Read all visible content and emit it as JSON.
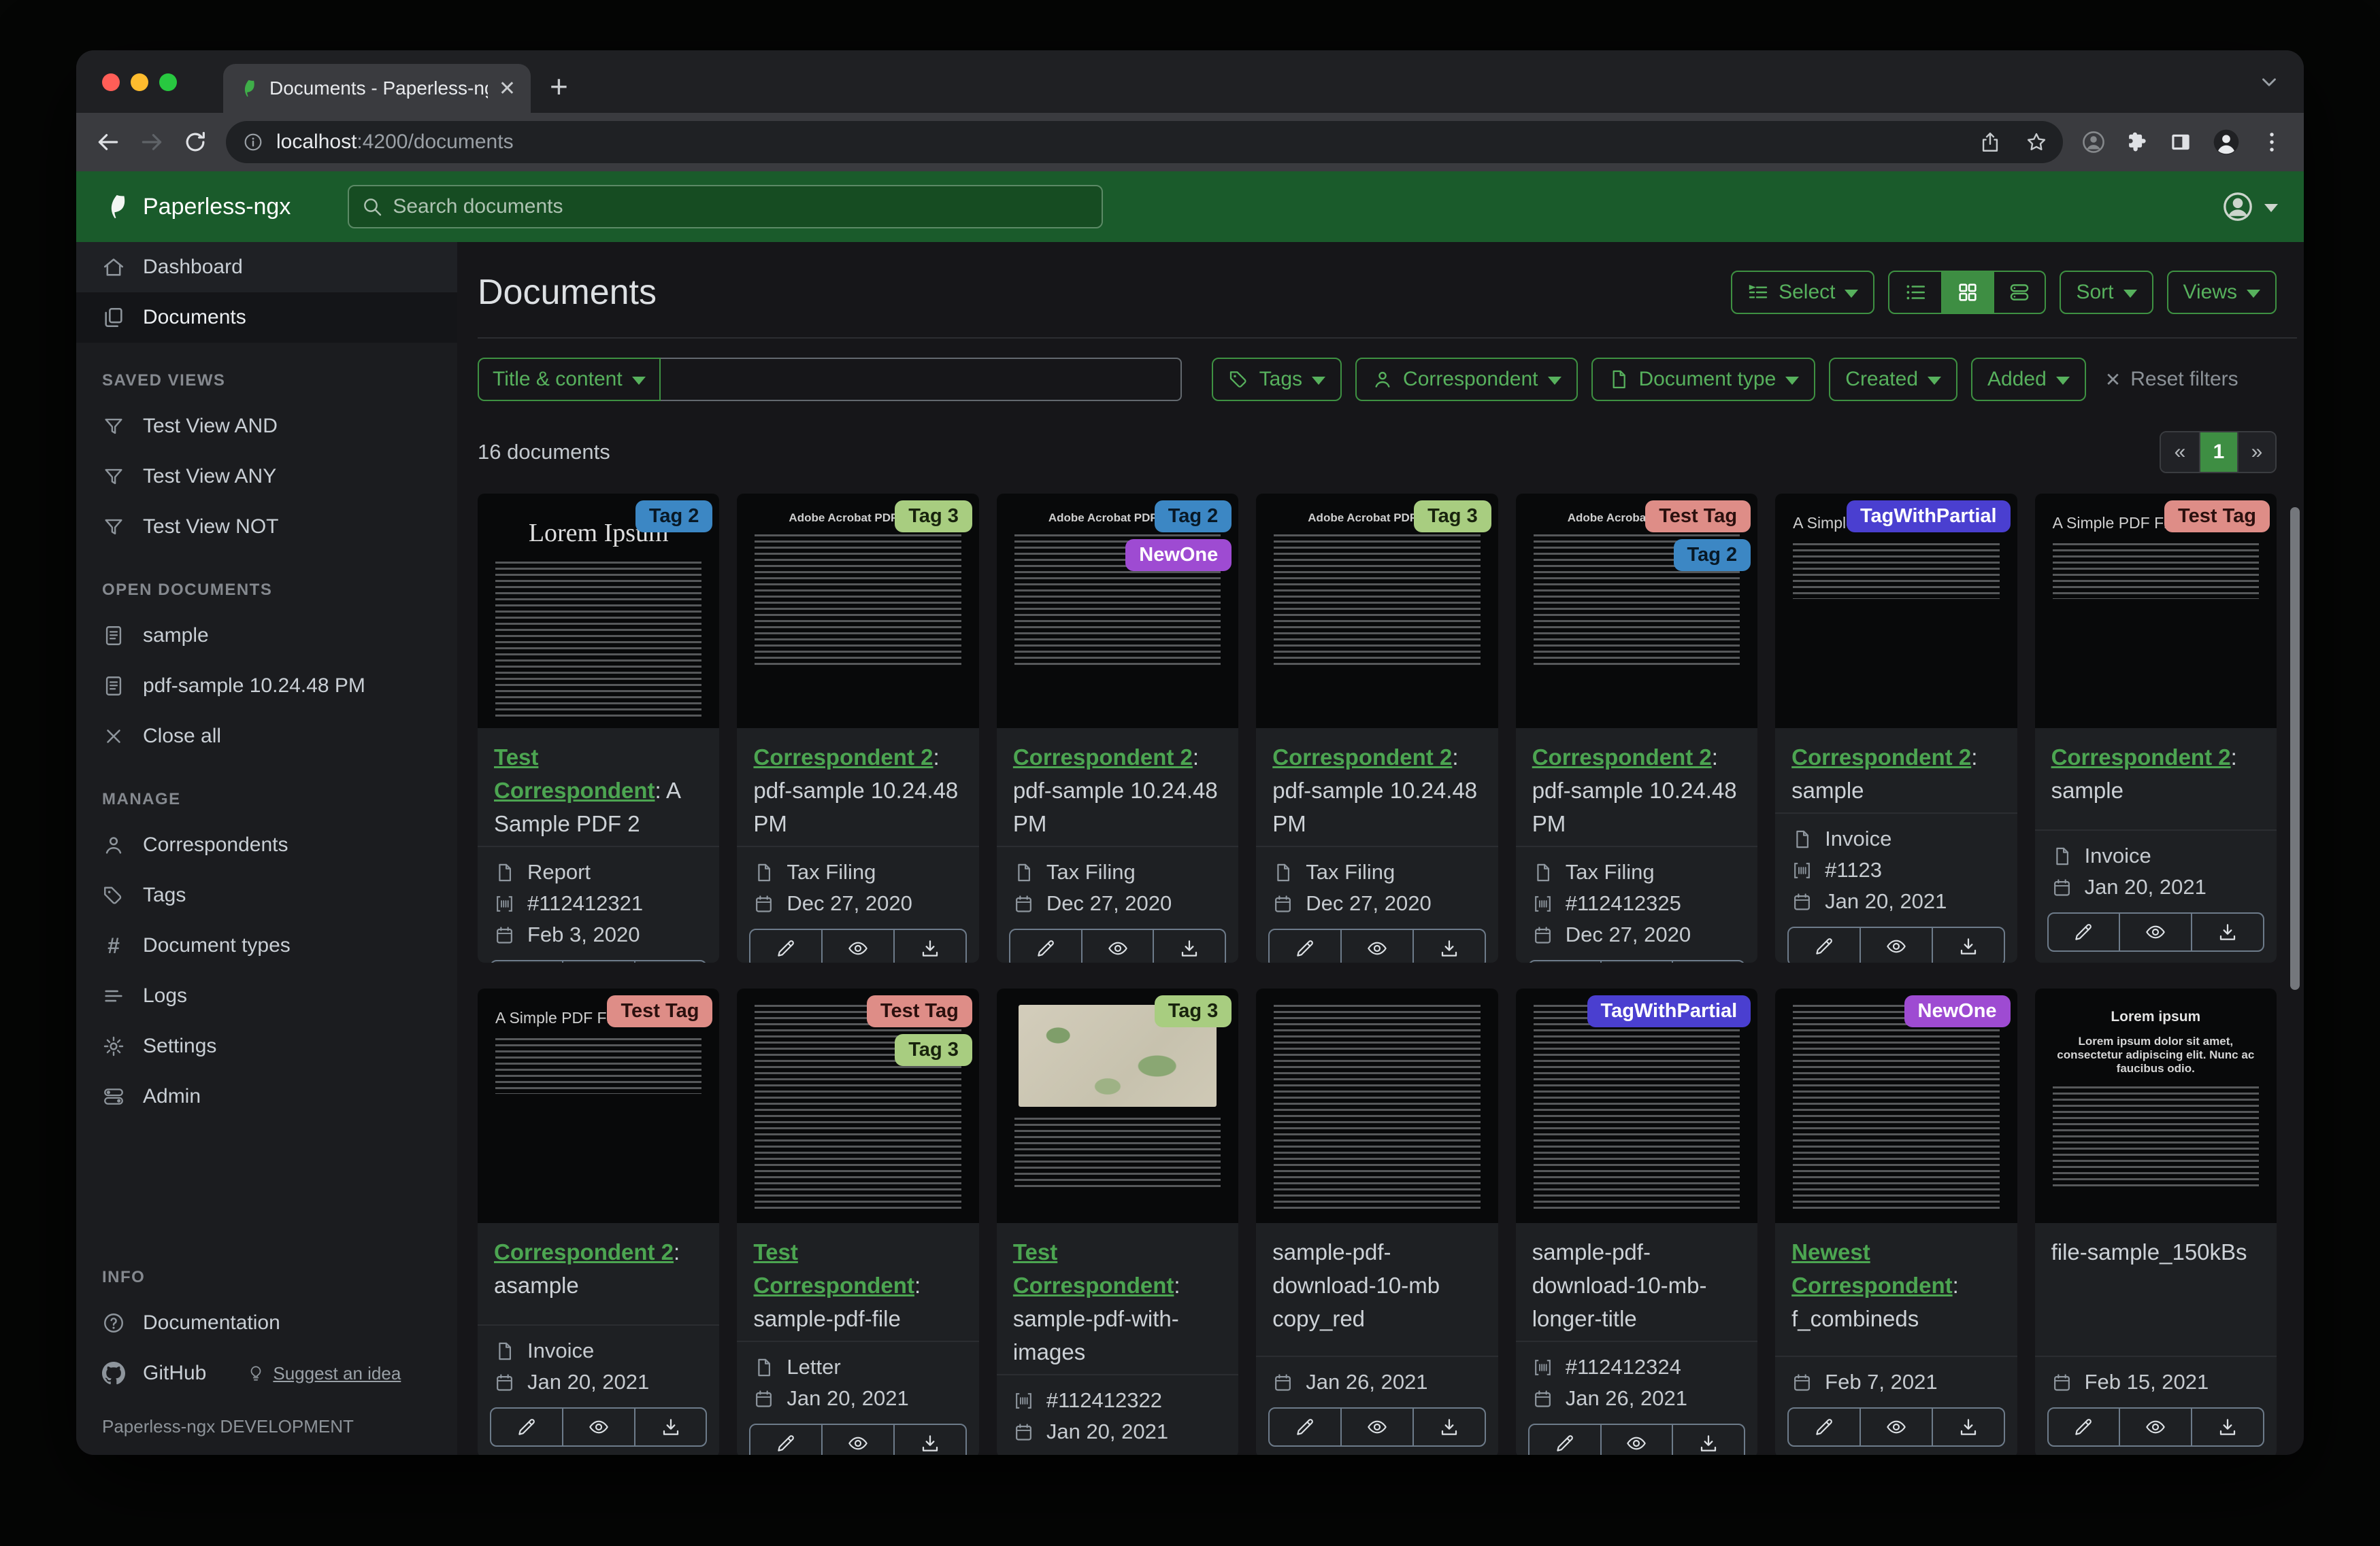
{
  "browser": {
    "tab_title": "Documents - Paperless-ngx",
    "url_host": "localhost",
    "url_path": ":4200/documents",
    "toolbar_icons": [
      "back",
      "forward",
      "reload",
      "page-info",
      "share",
      "bookmark-star",
      "profile-dim",
      "extensions-puzzle",
      "side-panel",
      "avatar",
      "kebab-menu"
    ]
  },
  "navbar": {
    "brand": "Paperless-ngx",
    "search_placeholder": "Search documents"
  },
  "sidebar": {
    "primary": [
      {
        "icon": "home",
        "label": "Dashboard",
        "active": false
      },
      {
        "icon": "documents",
        "label": "Documents",
        "active": true
      }
    ],
    "sections": [
      {
        "heading": "SAVED VIEWS",
        "bottom": false,
        "items": [
          {
            "icon": "filter",
            "label": "Test View AND"
          },
          {
            "icon": "filter",
            "label": "Test View ANY"
          },
          {
            "icon": "filter",
            "label": "Test View NOT"
          }
        ]
      },
      {
        "heading": "OPEN DOCUMENTS",
        "bottom": false,
        "items": [
          {
            "icon": "file-text",
            "label": "sample"
          },
          {
            "icon": "file-text",
            "label": "pdf-sample 10.24.48 PM"
          },
          {
            "icon": "close",
            "label": "Close all"
          }
        ]
      },
      {
        "heading": "MANAGE",
        "bottom": false,
        "items": [
          {
            "icon": "person",
            "label": "Correspondents"
          },
          {
            "icon": "tag",
            "label": "Tags"
          },
          {
            "icon": "hash",
            "label": "Document types"
          },
          {
            "icon": "list",
            "label": "Logs"
          },
          {
            "icon": "gear",
            "label": "Settings"
          },
          {
            "icon": "toggles",
            "label": "Admin"
          }
        ]
      },
      {
        "heading": "INFO",
        "bottom": true,
        "items": [
          {
            "icon": "help",
            "label": "Documentation"
          },
          {
            "icon": "github",
            "label": "GitHub",
            "extra": {
              "icon": "bulb",
              "label": "Suggest an idea"
            }
          }
        ]
      }
    ],
    "footer": "Paperless-ngx DEVELOPMENT"
  },
  "header": {
    "title": "Documents",
    "select": "Select",
    "sort": "Sort",
    "views": "Views"
  },
  "filters": {
    "field": "Title & content",
    "query": "",
    "buttons": [
      {
        "icon": "tag",
        "label": "Tags"
      },
      {
        "icon": "person",
        "label": "Correspondent"
      },
      {
        "icon": "file",
        "label": "Document type"
      },
      {
        "icon": null,
        "label": "Created"
      },
      {
        "icon": null,
        "label": "Added"
      }
    ],
    "reset": "Reset filters"
  },
  "results": {
    "count": "16 documents",
    "pager": {
      "prev": "«",
      "current": "1",
      "next": "»"
    }
  },
  "card_actions": [
    "edit",
    "preview",
    "download"
  ],
  "accent": {
    "navbar_green": "#1a5b2b",
    "button_green": "#3e9142",
    "active_green": "#3e8e43",
    "link_green": "#4ca551"
  },
  "tag_styles": {
    "Tag 2": {
      "bg": "#3c87c4",
      "fg": "#081825"
    },
    "Tag 3": {
      "bg": "#a8cd80",
      "fg": "#18230d"
    },
    "NewOne": {
      "bg": "#9e4bd2",
      "fg": "#ffffff"
    },
    "Test Tag": {
      "bg": "#de8d87",
      "fg": "#2b100e"
    },
    "TagWithPartial": {
      "bg": "#4a3fd0",
      "fg": "#ffffff"
    }
  },
  "cards": [
    {
      "tags": [
        "Tag 2"
      ],
      "correspondent": "Test Correspondent",
      "title": "A Sample PDF 2",
      "type": "Report",
      "asn": "#112412321",
      "date": "Feb 3, 2020",
      "thumb": "serif",
      "thumb_heading": "Lorem Ipsum"
    },
    {
      "tags": [
        "Tag 3"
      ],
      "correspondent": "Correspondent 2",
      "title": "pdf-sample 10.24.48 PM",
      "type": "Tax Filing",
      "asn": null,
      "date": "Dec 27, 2020",
      "thumb": "acrobat",
      "thumb_heading": "Adobe Acrobat PDF Files"
    },
    {
      "tags": [
        "Tag 2",
        "NewOne"
      ],
      "correspondent": "Correspondent 2",
      "title": "pdf-sample 10.24.48 PM",
      "type": "Tax Filing",
      "asn": null,
      "date": "Dec 27, 2020",
      "thumb": "acrobat",
      "thumb_heading": "Adobe Acrobat PDF Files"
    },
    {
      "tags": [
        "Tag 3"
      ],
      "correspondent": "Correspondent 2",
      "title": "pdf-sample 10.24.48 PM",
      "type": "Tax Filing",
      "asn": null,
      "date": "Dec 27, 2020",
      "thumb": "acrobat",
      "thumb_heading": "Adobe Acrobat PDF Files"
    },
    {
      "tags": [
        "Test Tag",
        "Tag 2"
      ],
      "correspondent": "Correspondent 2",
      "title": "pdf-sample 10.24.48 PM",
      "type": "Tax Filing",
      "asn": "#112412325",
      "date": "Dec 27, 2020",
      "thumb": "acrobat",
      "thumb_heading": "Adobe Acrobat PDF Files"
    },
    {
      "tags": [
        "TagWithPartial"
      ],
      "correspondent": "Correspondent 2",
      "title": "sample",
      "type": "Invoice",
      "asn": "#1123",
      "date": "Jan 20, 2021",
      "thumb": "simple",
      "thumb_heading": "A Simple PDF File"
    },
    {
      "tags": [
        "Test Tag"
      ],
      "correspondent": "Correspondent 2",
      "title": "sample",
      "type": "Invoice",
      "asn": null,
      "date": "Jan 20, 2021",
      "thumb": "simple",
      "thumb_heading": "A Simple PDF File"
    },
    {
      "tags": [
        "Test Tag"
      ],
      "correspondent": "Correspondent 2",
      "title": "asample",
      "type": "Invoice",
      "asn": null,
      "date": "Jan 20, 2021",
      "thumb": "simple",
      "thumb_heading": "A Simple PDF File"
    },
    {
      "tags": [
        "Test Tag",
        "Tag 3"
      ],
      "correspondent": "Test Correspondent",
      "title": "sample-pdf-file",
      "type": "Letter",
      "asn": null,
      "date": "Jan 20, 2021",
      "thumb": "dense",
      "thumb_heading": null
    },
    {
      "tags": [
        "Tag 3"
      ],
      "correspondent": "Test Correspondent",
      "title": "sample-pdf-with-images",
      "type": null,
      "asn": "#112412322",
      "date": "Jan 20, 2021",
      "thumb": "map",
      "thumb_heading": null
    },
    {
      "tags": [],
      "correspondent": null,
      "title": "sample-pdf-download-10-mb copy_red",
      "type": null,
      "asn": null,
      "date": "Jan 26, 2021",
      "thumb": "dense",
      "thumb_heading": null
    },
    {
      "tags": [
        "TagWithPartial"
      ],
      "correspondent": null,
      "title": "sample-pdf-download-10-mb-longer-title",
      "type": null,
      "asn": "#112412324",
      "date": "Jan 26, 2021",
      "thumb": "dense",
      "thumb_heading": null
    },
    {
      "tags": [
        "NewOne"
      ],
      "correspondent": "Newest Correspondent",
      "title": "f_combineds",
      "type": null,
      "asn": null,
      "date": "Feb 7, 2021",
      "thumb": "dense",
      "thumb_heading": null
    },
    {
      "tags": [],
      "correspondent": null,
      "title": "file-sample_150kBs",
      "type": null,
      "asn": null,
      "date": "Feb 15, 2021",
      "thumb": "bold",
      "thumb_heading": "Lorem ipsum",
      "thumb_subheading": "Lorem ipsum dolor sit amet, consectetur adipiscing elit. Nunc ac faucibus odio."
    }
  ]
}
